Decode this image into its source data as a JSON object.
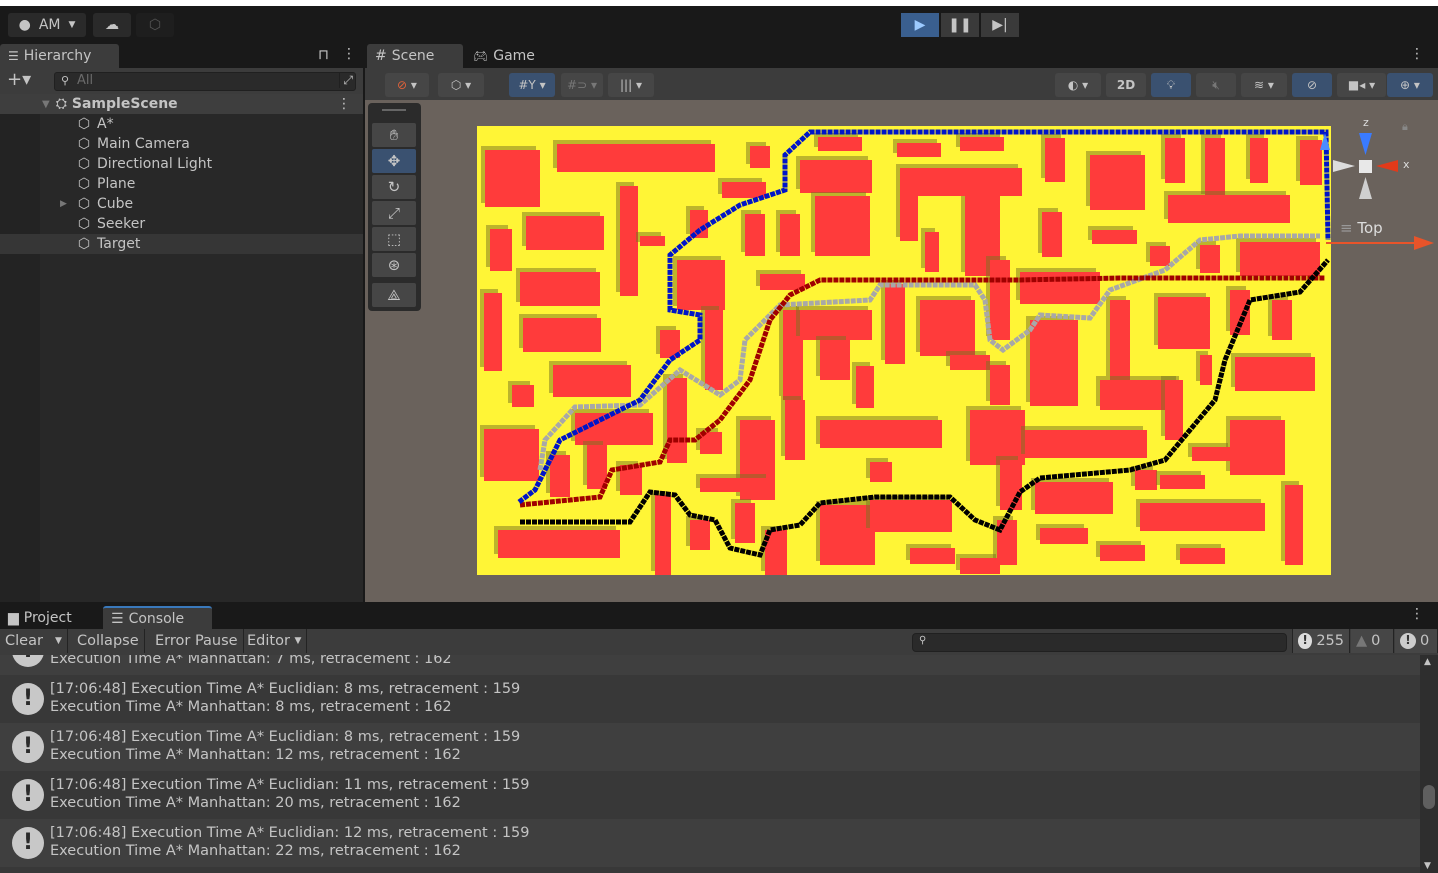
{
  "toolbar": {
    "account_label": "AM",
    "account_icon": "account-icon",
    "cloud_icon": "cloud-icon",
    "collab_icon": "plastic-scm-icon",
    "play_icon": "play-icon",
    "pause_icon": "pause-icon",
    "step_icon": "step-icon",
    "play_active_color": "#3a5f8f"
  },
  "hierarchy": {
    "title": "Hierarchy",
    "search_placeholder": "All",
    "scene_name": "SampleScene",
    "items": [
      {
        "label": "A*"
      },
      {
        "label": "Main Camera"
      },
      {
        "label": "Directional Light"
      },
      {
        "label": "Plane"
      },
      {
        "label": "Cube"
      },
      {
        "label": "Seeker"
      },
      {
        "label": "Target"
      }
    ]
  },
  "scene": {
    "tabs": [
      {
        "label": "Scene"
      },
      {
        "label": "Game"
      }
    ],
    "toolbar_2d_label": "2D",
    "orientation_label": "Top",
    "gizmo_axes": {
      "z": "z",
      "x": "x"
    },
    "colors": {
      "floor": "#fff536",
      "obstacle": "#ff3b3b",
      "path_astar_blue": "#0015c8",
      "path_gray": "#a8a8a8",
      "path_red": "#a00000",
      "path_black": "#000000"
    }
  },
  "bottom": {
    "tabs": [
      {
        "label": "Project"
      },
      {
        "label": "Console"
      }
    ],
    "console_toolbar": {
      "clear": "Clear",
      "collapse": "Collapse",
      "error_pause": "Error Pause",
      "editor": "Editor"
    },
    "counts": {
      "log": "255",
      "warning": "0",
      "error": "0"
    },
    "entries": [
      {
        "line1": "",
        "line2": "Execution Time A* Manhattan: 7 ms, retracement : 162"
      },
      {
        "line1": "[17:06:48] Execution Time A* Euclidian: 8 ms, retracement : 159",
        "line2": "Execution Time A* Manhattan: 8 ms, retracement : 162"
      },
      {
        "line1": "[17:06:48] Execution Time A* Euclidian: 8 ms, retracement : 159",
        "line2": "Execution Time A* Manhattan: 12 ms, retracement : 162"
      },
      {
        "line1": "[17:06:48] Execution Time A* Euclidian: 11 ms, retracement : 159",
        "line2": "Execution Time A* Manhattan: 20 ms, retracement : 162"
      },
      {
        "line1": "[17:06:48] Execution Time A* Euclidian: 12 ms, retracement : 159",
        "line2": "Execution Time A* Manhattan: 22 ms, retracement : 162"
      }
    ]
  }
}
